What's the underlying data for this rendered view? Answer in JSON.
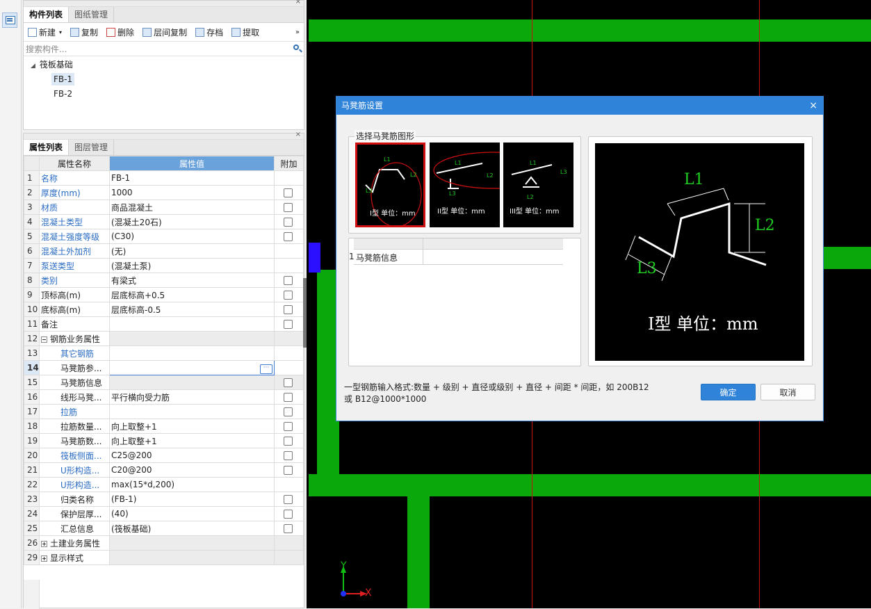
{
  "component_panel": {
    "tabs": [
      "构件列表",
      "图纸管理"
    ],
    "toolbar": {
      "new": "新建",
      "copy": "复制",
      "delete": "删除",
      "floor_copy": "层间复制",
      "archive": "存档",
      "extract": "提取"
    },
    "search_placeholder": "搜索构件...",
    "tree": {
      "group": "筏板基础",
      "items": [
        "FB-1",
        "FB-2"
      ]
    }
  },
  "property_panel": {
    "tabs": [
      "属性列表",
      "图层管理"
    ],
    "columns": [
      "属性名称",
      "属性值",
      "附加"
    ],
    "rows": [
      {
        "n": "1",
        "name": "名称",
        "value": "FB-1"
      },
      {
        "n": "2",
        "name": "厚度(mm)",
        "value": "1000"
      },
      {
        "n": "3",
        "name": "材质",
        "value": "商品混凝土"
      },
      {
        "n": "4",
        "name": "混凝土类型",
        "value": "(混凝土20石)"
      },
      {
        "n": "5",
        "name": "混凝土强度等级",
        "value": "(C30)"
      },
      {
        "n": "6",
        "name": "混凝土外加剂",
        "value": "(无)"
      },
      {
        "n": "7",
        "name": "泵送类型",
        "value": "(混凝土泵)"
      },
      {
        "n": "8",
        "name": "类别",
        "value": "有梁式"
      },
      {
        "n": "9",
        "name": "顶标高(m)",
        "value": "层底标高+0.5"
      },
      {
        "n": "10",
        "name": "底标高(m)",
        "value": "层底标高-0.5"
      },
      {
        "n": "11",
        "name": "备注",
        "value": ""
      },
      {
        "n": "12",
        "name": "钢筋业务属性",
        "value": ""
      },
      {
        "n": "13",
        "name": "其它钢筋",
        "value": ""
      },
      {
        "n": "14",
        "name": "马凳筋参...",
        "value": ""
      },
      {
        "n": "15",
        "name": "马凳筋信息",
        "value": ""
      },
      {
        "n": "16",
        "name": "线形马凳...",
        "value": "平行横向受力筋"
      },
      {
        "n": "17",
        "name": "拉筋",
        "value": ""
      },
      {
        "n": "18",
        "name": "拉筋数量...",
        "value": "向上取整+1"
      },
      {
        "n": "19",
        "name": "马凳筋数...",
        "value": "向上取整+1"
      },
      {
        "n": "20",
        "name": "筏板侧面...",
        "value": "C25@200"
      },
      {
        "n": "21",
        "name": "U形构造...",
        "value": "C20@200"
      },
      {
        "n": "22",
        "name": "U形构造...",
        "value": "max(15*d,200)"
      },
      {
        "n": "23",
        "name": "归类名称",
        "value": "(FB-1)"
      },
      {
        "n": "24",
        "name": "保护层厚...",
        "value": "(40)"
      },
      {
        "n": "25",
        "name": "汇总信息",
        "value": "(筏板基础)"
      },
      {
        "n": "26",
        "name": "土建业务属性",
        "value": ""
      },
      {
        "n": "29",
        "name": "显示样式",
        "value": ""
      }
    ]
  },
  "dialog": {
    "title": "马凳筋设置",
    "shape_group_label": "选择马凳筋图形",
    "thumbs": [
      {
        "caption": "I型 单位：mm",
        "labels": [
          "L1",
          "L2",
          "L3"
        ]
      },
      {
        "caption": "II型 单位：mm",
        "labels": [
          "L1",
          "L2",
          "L3"
        ]
      },
      {
        "caption": "III型 单位：mm",
        "labels": [
          "L1",
          "L3",
          "L2"
        ]
      }
    ],
    "info_table": {
      "row_num": "1",
      "row_label": "马凳筋信息"
    },
    "preview": {
      "caption": "I型 单位：mm",
      "l1": "L1",
      "l2": "L2",
      "l3": "L3"
    },
    "hint_line1": "一型钢筋输入格式:数量 + 级别 + 直径或级别 + 直径 + 间距 * 间距，如 200B12",
    "hint_line2": "或 B12@1000*1000",
    "ok": "确定",
    "cancel": "取消"
  },
  "axis": {
    "y": "Y",
    "x": "X"
  },
  "colors": {
    "accent": "#2f83d8",
    "green": "#0aa80a",
    "red_line": "#c31010"
  }
}
